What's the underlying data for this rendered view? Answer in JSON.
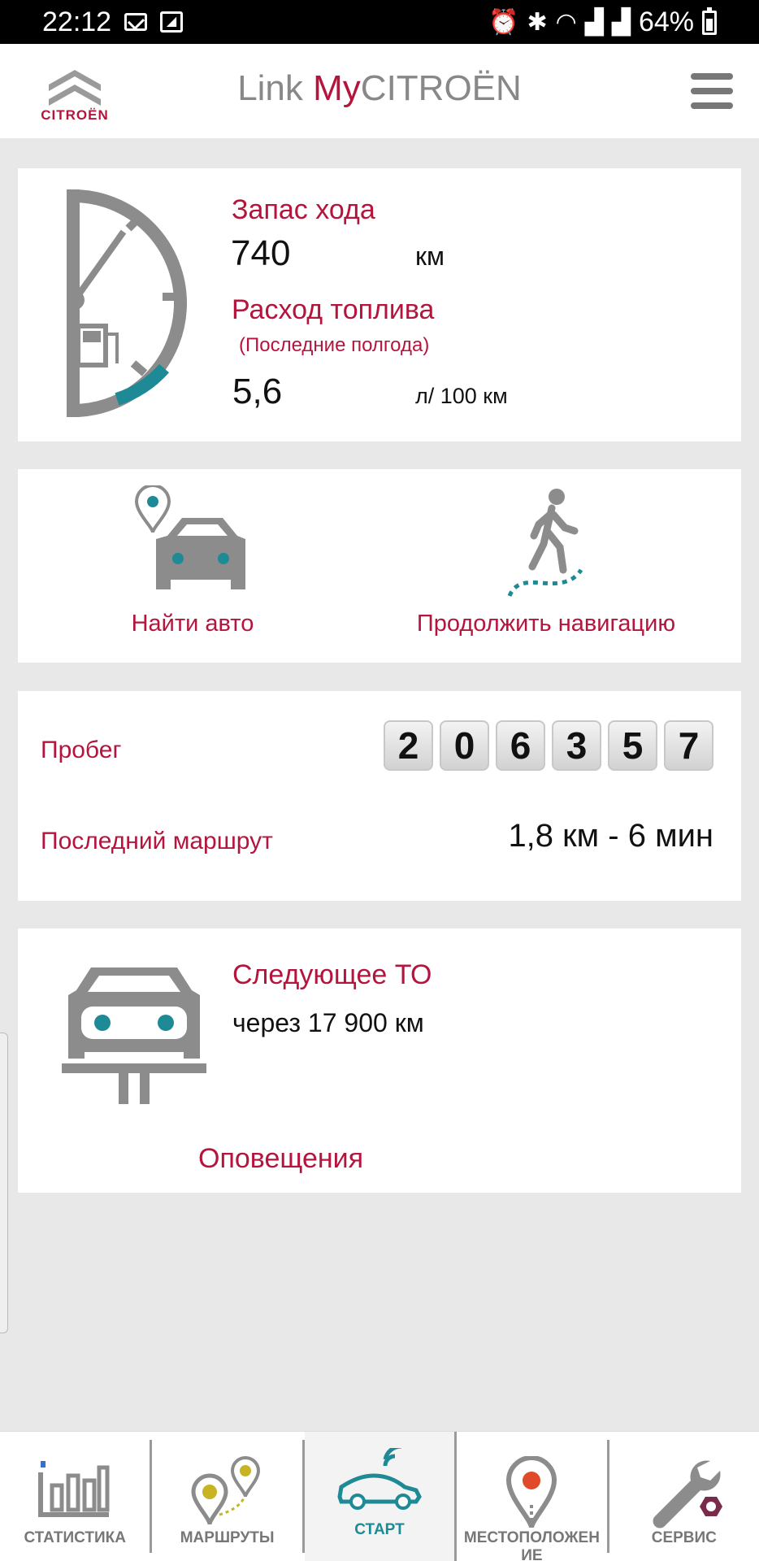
{
  "status_bar": {
    "time": "22:12",
    "battery": "64%",
    "icons": [
      "gmail-icon",
      "app-notification-icon",
      "alarm-icon",
      "bluetooth-icon",
      "wifi-icon",
      "signal-icon",
      "signal-icon",
      "battery-icon"
    ]
  },
  "header": {
    "logo_text": "CITROËN",
    "title_prefix": "Link ",
    "title_my": "My",
    "title_brand": "CITROËN"
  },
  "range_card": {
    "range_label": "Запас хода",
    "range_value": "740",
    "range_unit": "км",
    "consumption_label": "Расход топлива",
    "consumption_sub": "(Последние полгода)",
    "consumption_value": "5,6",
    "consumption_unit": "л/ 100 км"
  },
  "nav_card": {
    "find_car_label": "Найти авто",
    "continue_nav_label": "Продолжить навигацию"
  },
  "odometer_card": {
    "mileage_label": "Пробег",
    "digits": [
      "2",
      "0",
      "6",
      "3",
      "5",
      "7"
    ],
    "last_trip_label": "Последний маршрут",
    "last_trip_value": "1,8 км - 6 мин"
  },
  "service_card": {
    "next_service_label": "Следующее ТО",
    "next_service_value": "через 17 900 км",
    "alerts_label": "Оповещения"
  },
  "bottom_nav": {
    "items": [
      {
        "label": "СТАТИСТИКА",
        "icon": "statistics-icon"
      },
      {
        "label": "МАРШРУТЫ",
        "icon": "routes-icon"
      },
      {
        "label": "СТАРТ",
        "icon": "start-car-icon"
      },
      {
        "label": "МЕСТОПОЛОЖЕН ИЕ",
        "icon": "location-icon"
      },
      {
        "label": "СЕРВИС",
        "icon": "service-wrench-icon"
      }
    ],
    "active_index": 2
  },
  "colors": {
    "accent": "#b5153c",
    "teal": "#1e8a95",
    "gray_icon": "#8c8c8c"
  }
}
